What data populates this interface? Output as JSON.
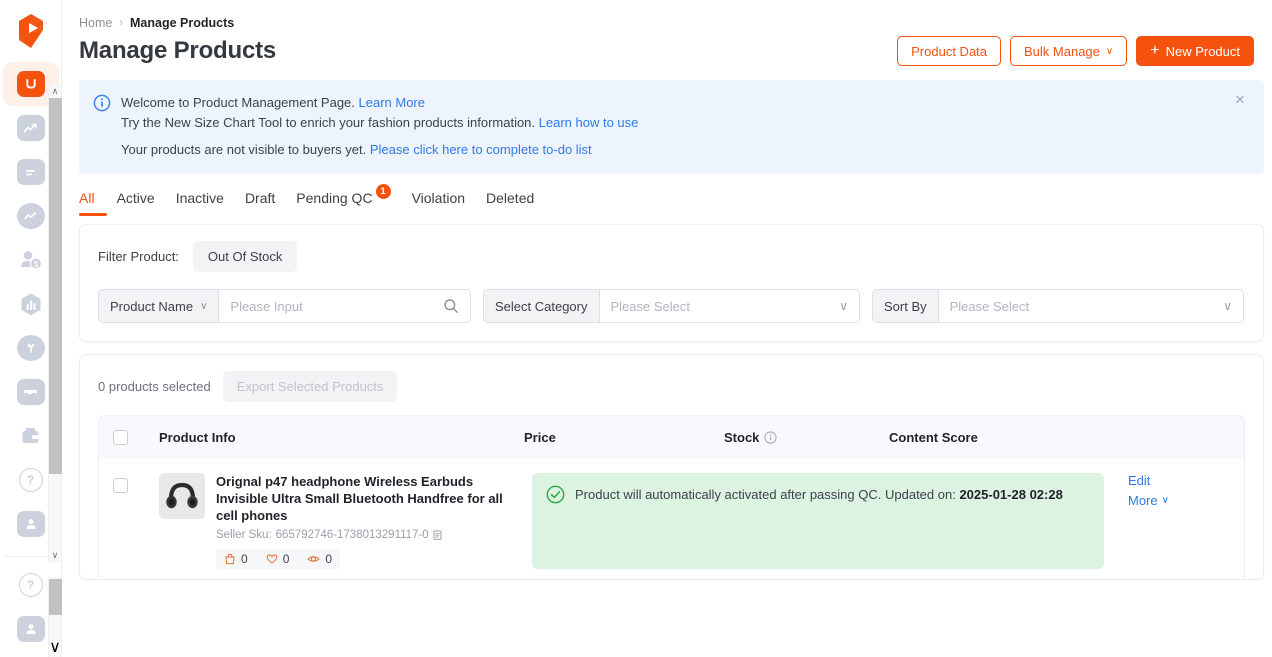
{
  "app": {
    "logo_color": "#f4520d",
    "accent": "#f4520d",
    "link_color": "#2f7ae5"
  },
  "sidebar": {
    "items": [
      {
        "name": "sidebar-item-home",
        "icon": "u-logo-icon",
        "glyph": "U",
        "active": true
      },
      {
        "name": "sidebar-item-analytics",
        "icon": "trending-up-icon",
        "glyph": "↗",
        "active": false
      },
      {
        "name": "sidebar-item-orders",
        "icon": "list-card-icon",
        "glyph": "≡",
        "active": false
      },
      {
        "name": "sidebar-item-performance",
        "icon": "line-chart-icon",
        "glyph": "∿",
        "active": false
      },
      {
        "name": "sidebar-item-finance",
        "icon": "money-person-icon",
        "glyph": "$",
        "active": false
      },
      {
        "name": "sidebar-item-data",
        "icon": "bar-chart-icon",
        "glyph": "‖",
        "active": false
      },
      {
        "name": "sidebar-item-growth",
        "icon": "sprout-icon",
        "glyph": "Ψ",
        "active": false
      },
      {
        "name": "sidebar-item-shop",
        "icon": "storefront-icon",
        "glyph": "⌂",
        "active": false
      },
      {
        "name": "sidebar-item-wallet",
        "icon": "wallet-icon",
        "glyph": "▭",
        "active": false
      },
      {
        "name": "sidebar-item-help",
        "icon": "question-circle-icon",
        "glyph": "?",
        "active": false
      },
      {
        "name": "sidebar-item-account",
        "icon": "user-icon",
        "glyph": "●",
        "active": false
      }
    ],
    "bottom_items": [
      {
        "name": "sidebar-bottom-help",
        "icon": "question-circle-icon",
        "glyph": "?"
      },
      {
        "name": "sidebar-bottom-account",
        "icon": "user-icon",
        "glyph": "●"
      }
    ],
    "scroll_up_arrow": "∧",
    "scroll_down_arrow": "∨"
  },
  "breadcrumb": {
    "home": "Home",
    "separator": "›",
    "current": "Manage Products"
  },
  "header": {
    "title": "Manage Products",
    "product_data_label": "Product Data",
    "bulk_manage_label": "Bulk Manage",
    "bulk_manage_caret": "∨",
    "new_product_label": "New Product",
    "new_product_plus": "+"
  },
  "banner": {
    "line1_text": "Welcome to Product Management Page.",
    "line1_link": "Learn More",
    "line2_text": "Try the New Size Chart Tool to enrich your fashion products information.",
    "line2_link": "Learn how to use",
    "line3_text": "Your products are not visible to buyers yet.",
    "line3_link": "Please click here to complete to-do list",
    "close_glyph": "×"
  },
  "tabs": [
    {
      "label": "All",
      "active": true,
      "badge": null
    },
    {
      "label": "Active",
      "active": false,
      "badge": null
    },
    {
      "label": "Inactive",
      "active": false,
      "badge": null
    },
    {
      "label": "Draft",
      "active": false,
      "badge": null
    },
    {
      "label": "Pending QC",
      "active": false,
      "badge": "1"
    },
    {
      "label": "Violation",
      "active": false,
      "badge": null
    },
    {
      "label": "Deleted",
      "active": false,
      "badge": null
    }
  ],
  "filters": {
    "filter_product_label": "Filter Product:",
    "out_of_stock_label": "Out Of Stock",
    "product_name_label": "Product Name",
    "product_name_caret": "∨",
    "product_name_placeholder": "Please Input",
    "product_name_value": "",
    "select_category_label": "Select Category",
    "select_category_placeholder": "Please Select",
    "select_category_value": "",
    "select_category_caret": "∨",
    "sort_by_label": "Sort By",
    "sort_by_placeholder": "Please Select",
    "sort_by_value": "",
    "sort_by_caret": "∨"
  },
  "list": {
    "selected_count_label": "0 products selected",
    "export_label": "Export Selected Products",
    "columns": {
      "product_info": "Product Info",
      "price": "Price",
      "stock": "Stock",
      "content_score": "Content Score"
    },
    "rows": [
      {
        "name": "Orignal p47 headphone Wireless Earbuds Invisible Ultra Small Bluetooth Handfree for all cell phones",
        "sku_label": "Seller Sku:",
        "sku_value": "665792746-1738013291117-0",
        "stats": [
          {
            "icon": "bag-icon",
            "value": "0"
          },
          {
            "icon": "heart-icon",
            "value": "0"
          },
          {
            "icon": "eye-icon",
            "value": "0"
          }
        ],
        "qc_message": "Product will automatically activated after passing QC.",
        "qc_updated_label": "Updated on:",
        "qc_updated_value": "2025-01-28 02:28",
        "edit_label": "Edit",
        "more_label": "More",
        "more_caret": "∨"
      }
    ]
  }
}
